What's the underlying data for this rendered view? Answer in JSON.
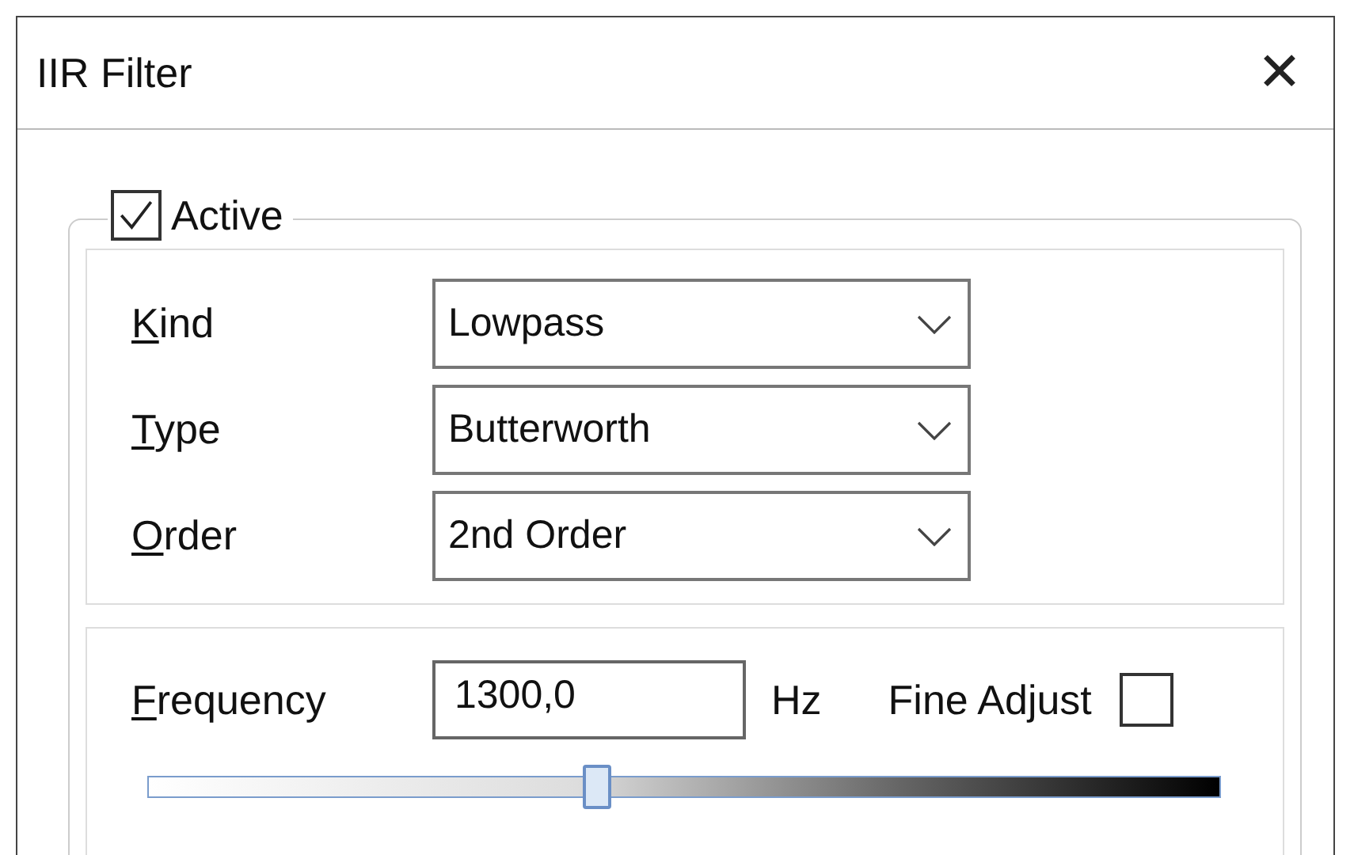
{
  "window": {
    "title": "IIR Filter",
    "close": "✕"
  },
  "group": {
    "label": "Active",
    "checked": true
  },
  "fields": [
    {
      "label": "Kind",
      "value": "Lowpass"
    },
    {
      "label": "Type",
      "value": "Butterworth"
    },
    {
      "label": "Order",
      "value": "2nd Order"
    }
  ],
  "frequency": {
    "label": "Frequency",
    "value": "1300,0",
    "unit": "Hz",
    "fine_adjust": {
      "label": "Fine Adjust",
      "checked": false
    },
    "slider": {
      "level": 0.42
    }
  }
}
